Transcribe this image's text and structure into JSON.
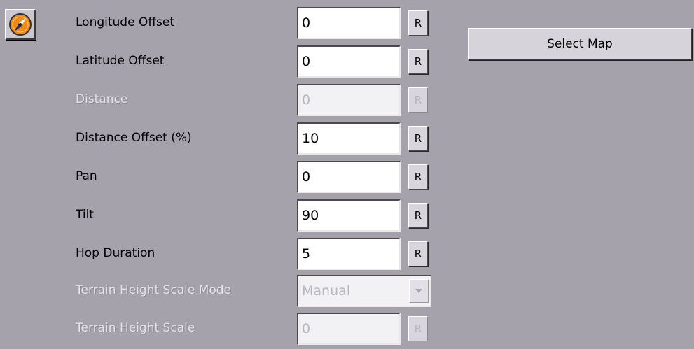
{
  "plugin": {
    "icon": "compass-icon"
  },
  "fields": [
    {
      "label": "Longitude Offset",
      "value": "0",
      "reset": "R",
      "enabled": true
    },
    {
      "label": "Latitude Offset",
      "value": "0",
      "reset": "R",
      "enabled": true
    },
    {
      "label": "Distance",
      "value": "0",
      "reset": "R",
      "enabled": false
    },
    {
      "label": "Distance Offset (%)",
      "value": "10",
      "reset": "R",
      "enabled": true
    },
    {
      "label": "Pan",
      "value": "0",
      "reset": "R",
      "enabled": true
    },
    {
      "label": "Tilt",
      "value": "90",
      "reset": "R",
      "enabled": true
    },
    {
      "label": "Hop Duration",
      "value": "5",
      "reset": "R",
      "enabled": true
    }
  ],
  "terrain_mode": {
    "label": "Terrain Height Scale Mode",
    "value": "Manual",
    "enabled": false
  },
  "terrain_scale": {
    "label": "Terrain Height Scale",
    "value": "0",
    "reset": "R",
    "enabled": false
  },
  "select_map": {
    "label": "Select Map"
  },
  "colors": {
    "panel_bg": "#a5a2ac",
    "disabled_text": "#e4e2e8",
    "compass_orange": "#f08a12"
  }
}
